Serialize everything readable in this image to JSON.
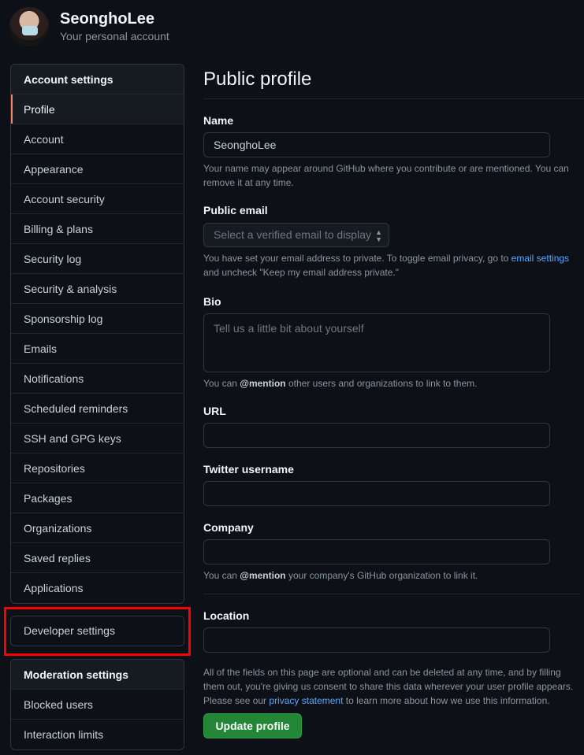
{
  "user": {
    "name": "SeonghoLee",
    "subtitle": "Your personal account"
  },
  "sidebar": {
    "account_heading": "Account settings",
    "items": [
      {
        "label": "Profile",
        "selected": true
      },
      {
        "label": "Account"
      },
      {
        "label": "Appearance"
      },
      {
        "label": "Account security"
      },
      {
        "label": "Billing & plans"
      },
      {
        "label": "Security log"
      },
      {
        "label": "Security & analysis"
      },
      {
        "label": "Sponsorship log"
      },
      {
        "label": "Emails"
      },
      {
        "label": "Notifications"
      },
      {
        "label": "Scheduled reminders"
      },
      {
        "label": "SSH and GPG keys"
      },
      {
        "label": "Repositories"
      },
      {
        "label": "Packages"
      },
      {
        "label": "Organizations"
      },
      {
        "label": "Saved replies"
      },
      {
        "label": "Applications"
      }
    ],
    "developer_settings": "Developer settings",
    "moderation_heading": "Moderation settings",
    "moderation_items": [
      {
        "label": "Blocked users"
      },
      {
        "label": "Interaction limits"
      }
    ]
  },
  "main": {
    "title": "Public profile",
    "name_label": "Name",
    "name_value": "SeonghoLee",
    "name_note": "Your name may appear around GitHub where you contribute or are mentioned. You can remove it at any time.",
    "email_label": "Public email",
    "email_placeholder": "Select a verified email to display",
    "email_note_pre": "You have set your email address to private. To toggle email privacy, go to ",
    "email_note_link": "email settings",
    "email_note_post": " and uncheck \"Keep my email address private.\"",
    "bio_label": "Bio",
    "bio_placeholder": "Tell us a little bit about yourself",
    "bio_note_pre": "You can ",
    "bio_note_mention": "@mention",
    "bio_note_post": " other users and organizations to link to them.",
    "url_label": "URL",
    "twitter_label": "Twitter username",
    "company_label": "Company",
    "company_note_pre": "You can ",
    "company_note_mention": "@mention",
    "company_note_post": " your company's GitHub organization to link it.",
    "location_label": "Location",
    "footer_note_pre": "All of the fields on this page are optional and can be deleted at any time, and by filling them out, you're giving us consent to share this data wherever your user profile appears. Please see our ",
    "footer_note_link": "privacy statement",
    "footer_note_post": " to learn more about how we use this information.",
    "update_button": "Update profile"
  },
  "colors": {
    "background": "#0d1117",
    "accent_selected": "#f78166",
    "link": "#58a6ff",
    "primary_button": "#238636",
    "highlight_box": "#ff0000"
  }
}
